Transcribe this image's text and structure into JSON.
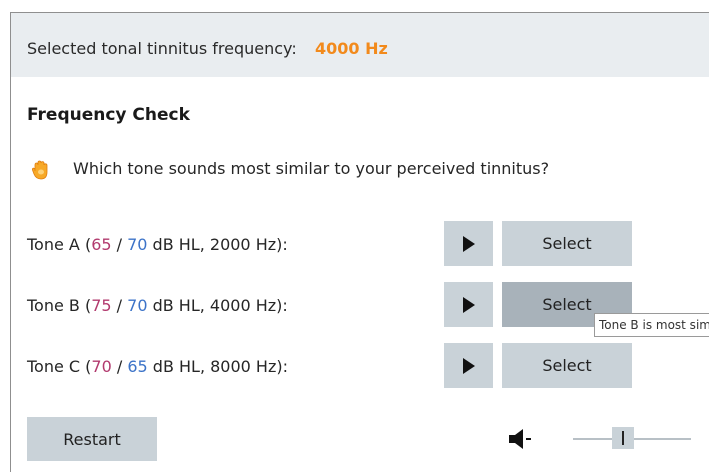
{
  "header": {
    "label": "Selected tonal tinnitus frequency:",
    "value": "4000 Hz"
  },
  "section_title": "Frequency Check",
  "question": {
    "icon": "hand-icon",
    "text": "Which tone sounds most similar to your perceived tinnitus?"
  },
  "tones": [
    {
      "prefix": "Tone A (",
      "left_db": "65",
      "sep": " / ",
      "right_db": "70",
      "suffix": " dB HL, 2000 Hz):",
      "select_label": "Select"
    },
    {
      "prefix": "Tone B (",
      "left_db": "75",
      "sep": " / ",
      "right_db": "70",
      "suffix": " dB HL, 4000 Hz):",
      "select_label": "Select"
    },
    {
      "prefix": "Tone C (",
      "left_db": "70",
      "sep": " / ",
      "right_db": "65",
      "suffix": " dB HL, 8000 Hz):",
      "select_label": "Select"
    }
  ],
  "tooltip": "Tone B is most similar",
  "restart_label": "Restart",
  "volume": {
    "icon": "speaker-icon",
    "level": 0.42
  },
  "colors": {
    "accent": "#f28a1c",
    "left_ear": "#b23a6e",
    "right_ear": "#3c73c8",
    "button": "#c9d2d8",
    "header_bg": "#e9edf0"
  }
}
